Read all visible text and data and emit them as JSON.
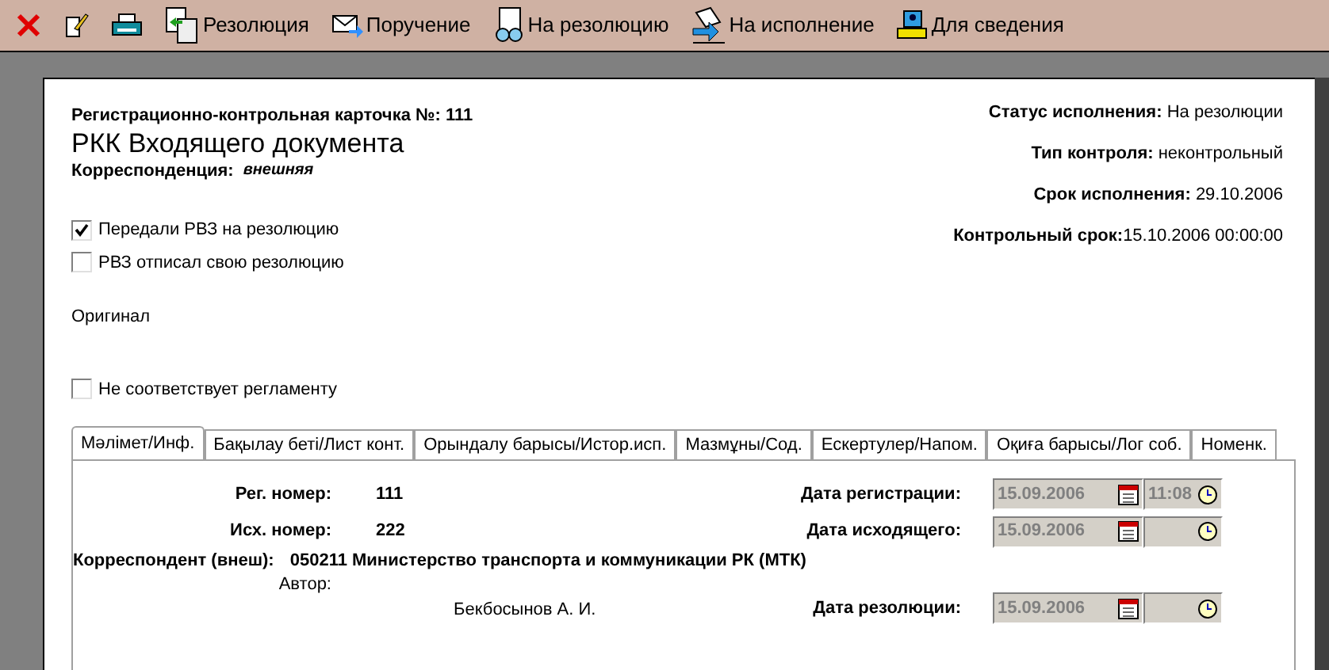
{
  "toolbar": [
    {
      "kind": "close"
    },
    {
      "kind": "edit"
    },
    {
      "kind": "print"
    },
    {
      "kind": "resolution",
      "label": "Резолюция"
    },
    {
      "kind": "order",
      "label": "Поручение"
    },
    {
      "kind": "review",
      "label": "На резолюцию"
    },
    {
      "kind": "execute",
      "label": "На исполнение"
    },
    {
      "kind": "info",
      "label": "Для сведения"
    }
  ],
  "card": {
    "number_line": "Регистрационно-контрольная карточка №: 111",
    "title": "РКК Входящего документа",
    "correspondence_label": "Корреспонденция:",
    "correspondence_value": "внешняя"
  },
  "status": [
    {
      "label": "Статус исполнения:",
      "value": "На резолюции"
    },
    {
      "label": "Тип контроля:",
      "value": "неконтрольный"
    },
    {
      "label": "Срок исполнения:",
      "value": "29.10.2006"
    },
    {
      "label": "Контрольный срок:",
      "value": "15.10.2006 00:00:00"
    }
  ],
  "checkboxes": [
    {
      "label": "Передали РВЗ на резолюцию",
      "checked": true
    },
    {
      "label": "РВЗ отписал свою резолюцию",
      "checked": false
    }
  ],
  "original_label": "Оригинал",
  "regulation_checkbox": {
    "label": "Не соответствует регламенту",
    "checked": false
  },
  "tabs": [
    {
      "label": "Мәлімет/Инф.",
      "selected": true
    },
    {
      "label": "Бақылау беті/Лист конт.",
      "selected": false
    },
    {
      "label": "Орындалу барысы/Истор.исп.",
      "selected": false
    },
    {
      "label": "Мазмұны/Сод.",
      "selected": false
    },
    {
      "label": "Ескертулер/Напом.",
      "selected": false
    },
    {
      "label": "Оқиға барысы/Лог соб.",
      "selected": false
    },
    {
      "label": "Номенк.",
      "selected": false
    }
  ],
  "info": {
    "reg_number_label": "Рег. номер:",
    "reg_number": "111",
    "out_number_label": "Исх. номер:",
    "out_number": "222",
    "correspondent_label": "Корреспондент (внеш):",
    "correspondent": "050211 Министерство транспорта и коммуникации РК (МТК)",
    "author_label": "Автор:",
    "author": "Бекбосынов А. И.",
    "dates": [
      {
        "label": "Дата регистрации:",
        "date": "15.09.2006",
        "time": "11:08"
      },
      {
        "label": "Дата исходящего:",
        "date": "15.09.2006"
      },
      {
        "label": "Дата резолюции:",
        "date": "15.09.2006"
      }
    ]
  }
}
